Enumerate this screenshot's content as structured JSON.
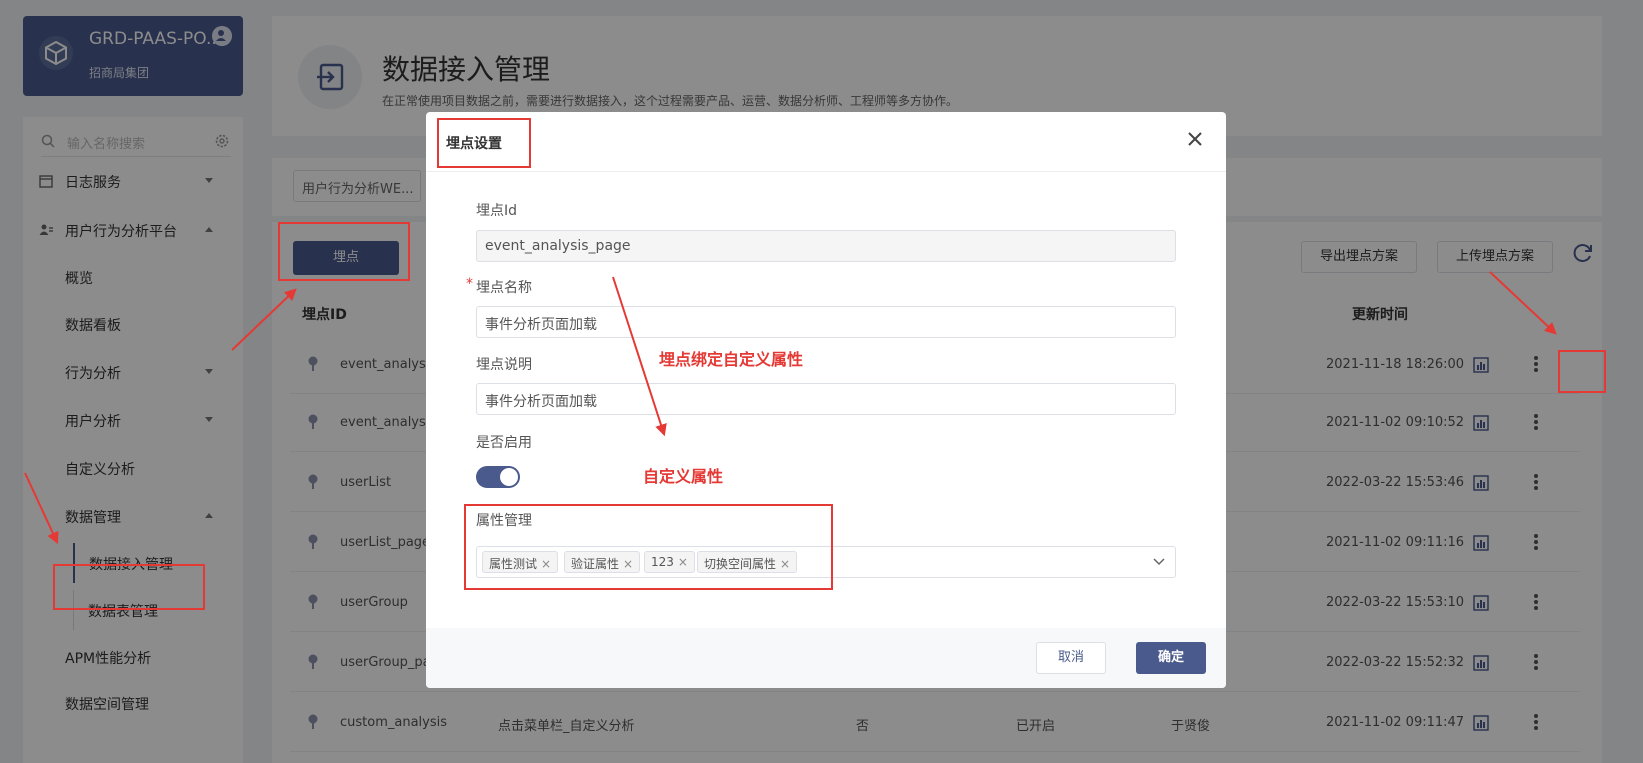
{
  "sidebar": {
    "brand_title": "GRD-PAAS-PO...",
    "brand_subtitle": "招商局集团",
    "search_placeholder": "输入名称搜索",
    "items": [
      {
        "label": "日志服务"
      },
      {
        "label": "用户行为分析平台"
      },
      {
        "label": "概览"
      },
      {
        "label": "数据看板"
      },
      {
        "label": "行为分析"
      },
      {
        "label": "用户分析"
      },
      {
        "label": "自定义分析"
      },
      {
        "label": "数据管理"
      },
      {
        "label": "数据接入管理"
      },
      {
        "label": "数据表管理"
      },
      {
        "label": "APM性能分析"
      },
      {
        "label": "数据空间管理"
      }
    ]
  },
  "header": {
    "title": "数据接入管理",
    "description": "在正常使用项目数据之前，需要进行数据接入，这个过程需要产品、运营、数据分析师、工程师等多方协作。"
  },
  "filter": {
    "select_value": "用户行为分析WE..."
  },
  "toolbar": {
    "track_button": "埋点",
    "export_button": "导出埋点方案",
    "upload_button": "上传埋点方案"
  },
  "table": {
    "headers": {
      "id": "埋点ID",
      "updated": "更新时间"
    },
    "rows": [
      {
        "id": "event_analysis_",
        "time": "2021-11-18 18:26:00"
      },
      {
        "id": "event_analysis",
        "time": "2021-11-02 09:10:52"
      },
      {
        "id": "userList",
        "time": "2022-03-22 15:53:46"
      },
      {
        "id": "userList_page",
        "time": "2021-11-02 09:11:16"
      },
      {
        "id": "userGroup",
        "time": "2022-03-22 15:53:10"
      },
      {
        "id": "userGroup_pag",
        "time": "2022-03-22 15:52:32"
      },
      {
        "id": "custom_analysis",
        "name": "点击菜单栏_自定义分析",
        "bound": "否",
        "status": "已开启",
        "owner": "于贤俊",
        "time": "2021-11-02 09:11:47"
      }
    ]
  },
  "modal": {
    "title": "埋点设置",
    "id_label": "埋点Id",
    "id_value": "event_analysis_page",
    "name_label": "埋点名称",
    "required_mark": "*",
    "name_value": "事件分析页面加载",
    "desc_label": "埋点说明",
    "desc_value": "事件分析页面加载",
    "enabled_label": "是否启用",
    "enabled": true,
    "attr_label": "属性管理",
    "tags": [
      "属性测试",
      "验证属性",
      "123",
      "切换空间属性"
    ],
    "tag_remove_glyph": "×",
    "cancel": "取消",
    "confirm": "确定"
  },
  "annotations": {
    "bind_custom": "埋点绑定自定义属性",
    "custom_attr": "自定义属性"
  },
  "colors": {
    "primary": "#4a5a8c",
    "annotation_red": "#e53935"
  }
}
